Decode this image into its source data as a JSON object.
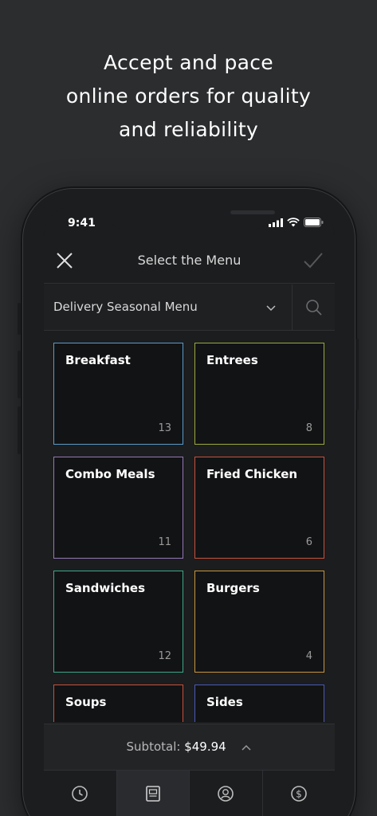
{
  "headline": {
    "line1": "Accept and pace",
    "line2": "online orders for quality",
    "line3": "and reliability"
  },
  "status_bar": {
    "time": "9:41"
  },
  "nav": {
    "title": "Select the Menu"
  },
  "menu_selector": {
    "selected": "Delivery Seasonal Menu"
  },
  "categories": [
    {
      "name": "Breakfast",
      "count": "13",
      "color": "#5b9bc8"
    },
    {
      "name": "Entrees",
      "count": "8",
      "color": "#9aaa3c"
    },
    {
      "name": "Combo Meals",
      "count": "11",
      "color": "#9478b8"
    },
    {
      "name": "Fried Chicken",
      "count": "6",
      "color": "#c8503c"
    },
    {
      "name": "Sandwiches",
      "count": "12",
      "color": "#3ca888"
    },
    {
      "name": "Burgers",
      "count": "4",
      "color": "#c8963c"
    },
    {
      "name": "Soups",
      "count": "",
      "color": "#c8503c"
    },
    {
      "name": "Sides",
      "count": "",
      "color": "#4a5ab8"
    }
  ],
  "subtotal": {
    "label": "Subtotal:",
    "value": "$49.94"
  },
  "tabs": [
    {
      "icon": "clock-icon"
    },
    {
      "icon": "menu-book-icon"
    },
    {
      "icon": "customer-icon"
    },
    {
      "icon": "dollar-icon"
    }
  ],
  "colors": {
    "background": "#2b2d2f",
    "screen": "#1c1d1f",
    "card_bg": "#121314"
  }
}
